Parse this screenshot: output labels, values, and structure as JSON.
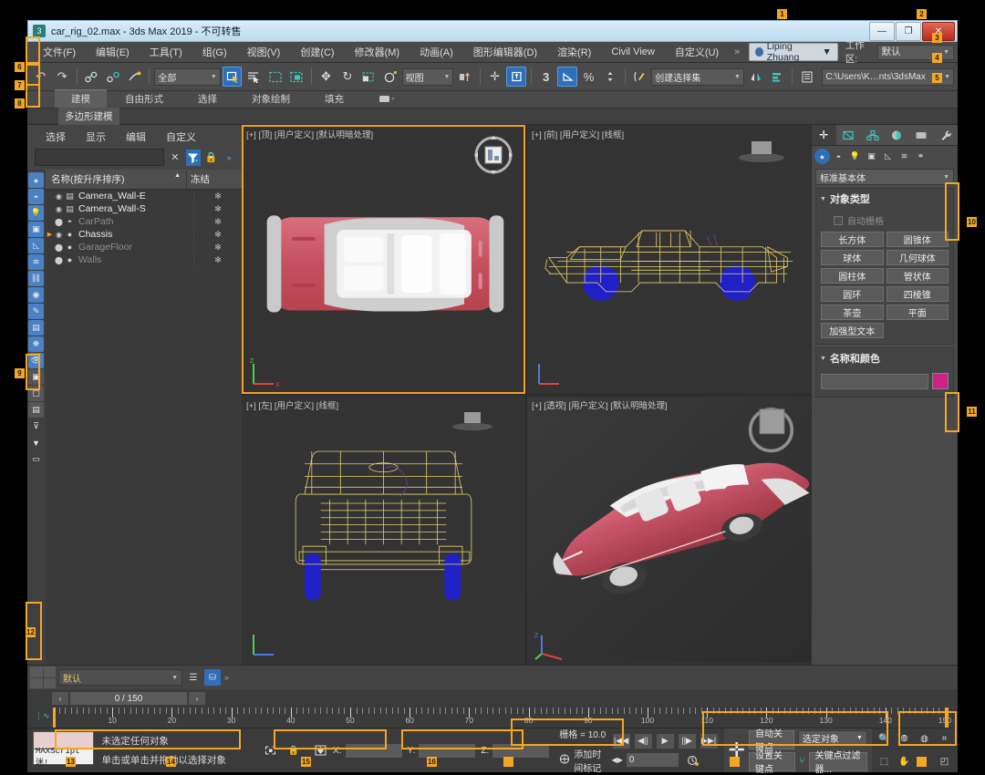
{
  "window": {
    "title": "car_rig_02.max - 3ds Max 2019  - 不可转售",
    "app_icon": "max-icon",
    "buttons": {
      "minimize": "—",
      "maximize": "❐",
      "close": "✕"
    }
  },
  "menu": {
    "items": [
      {
        "label": "文件(F)"
      },
      {
        "label": "编辑(E)"
      },
      {
        "label": "工具(T)"
      },
      {
        "label": "组(G)"
      },
      {
        "label": "视图(V)"
      },
      {
        "label": "创建(C)"
      },
      {
        "label": "修改器(M)"
      },
      {
        "label": "动画(A)"
      },
      {
        "label": "图形编辑器(D)"
      },
      {
        "label": "渲染(R)"
      },
      {
        "label": "Civil View"
      },
      {
        "label": "自定义(U)"
      }
    ],
    "overflow": "»",
    "user": "Liping Zhuang",
    "user_caret": "▼",
    "workspace_label": "工作区:",
    "workspace_value": "默认"
  },
  "toolbar": {
    "undo": "↶",
    "redo": "↷",
    "link": "link-icon",
    "unlink": "unlink-icon",
    "bind": "bind-icon",
    "filter_value": "全部",
    "select_object": "select-icon",
    "select_by_name": "select-name-icon",
    "rect_select": "rect-select-icon",
    "window_cross": "window-crossing-icon",
    "move": "✥",
    "rotate": "↻",
    "scale": "scale-icon",
    "placement": "placement-icon",
    "ref_coord_value": "视图",
    "pivot": "pivot-icon",
    "mirror": "mirror-icon",
    "snap3": "3",
    "angle_snap": "angle-snap-icon",
    "percent_snap": "%",
    "spinner_snap": "spinner-icon",
    "edit_named_sel": "named-sel-icon",
    "named_sel_value": "创建选择集",
    "mirror_tool": "mirror-tool-icon",
    "align": "align-icon",
    "layer_mgr": "layer-manager-icon",
    "path_value": "C:\\Users\\K…nts\\3dsMax"
  },
  "ribbon": {
    "tabs": [
      {
        "label": "建模",
        "active": true
      },
      {
        "label": "自由形式",
        "active": false
      },
      {
        "label": "选择",
        "active": false
      },
      {
        "label": "对象绘制",
        "active": false
      },
      {
        "label": "填充",
        "active": false
      }
    ],
    "overflow_icon": "dropdown-icon",
    "subtitle": "多边形建模"
  },
  "explorer": {
    "menus": [
      "选择",
      "显示",
      "编辑",
      "自定义"
    ],
    "search_value": "",
    "clear_icon": "✕",
    "filter_icon": "filter-icon",
    "lock_icon": "🔒",
    "expand_icon": "»",
    "columns": {
      "name": "名称(按升序排序)",
      "sort_arrow": "▲",
      "frozen": "冻结"
    },
    "rows": [
      {
        "name": "Camera_Wall-E",
        "type": "camera",
        "dim": false,
        "expandable": false,
        "frozen": "✻"
      },
      {
        "name": "Camera_Wall-S",
        "type": "camera",
        "dim": false,
        "expandable": false,
        "frozen": "✻"
      },
      {
        "name": "CarPath",
        "type": "shape",
        "dim": true,
        "expandable": false,
        "frozen": "✻"
      },
      {
        "name": "Chassis",
        "type": "geometry",
        "dim": false,
        "expandable": true,
        "frozen": "✻"
      },
      {
        "name": "GarageFloor",
        "type": "geometry",
        "dim": true,
        "expandable": false,
        "frozen": "✻"
      },
      {
        "name": "Walls",
        "type": "geometry",
        "dim": true,
        "expandable": false,
        "frozen": "✻"
      }
    ],
    "side_icons": [
      {
        "name": "all-icon",
        "glyph": "●",
        "state": "on"
      },
      {
        "name": "geometry-icon",
        "glyph": "◓",
        "state": "on"
      },
      {
        "name": "lights-icon",
        "glyph": "💡",
        "state": "on"
      },
      {
        "name": "cameras-icon",
        "glyph": "▣",
        "state": "on"
      },
      {
        "name": "helpers-icon",
        "glyph": "◺",
        "state": "on"
      },
      {
        "name": "space-warps-icon",
        "glyph": "≋",
        "state": "on"
      },
      {
        "name": "bones-icon",
        "glyph": "⛓",
        "state": "on"
      },
      {
        "name": "groups-icon",
        "glyph": "◉",
        "state": "on"
      },
      {
        "name": "xrefs-icon",
        "glyph": "✎",
        "state": "on"
      },
      {
        "name": "containers-icon",
        "glyph": "▤",
        "state": "on"
      },
      {
        "name": "particles-icon",
        "glyph": "❋",
        "state": "on"
      },
      {
        "name": "visibility-icon",
        "glyph": "👁",
        "state": "on"
      },
      {
        "name": "layers-icon",
        "glyph": "▣",
        "state": "off"
      },
      {
        "name": "objects-icon",
        "glyph": "▢",
        "state": "off"
      },
      {
        "name": "outline-icon",
        "glyph": "▤",
        "state": "off"
      },
      {
        "name": "filter-a-icon",
        "glyph": "⊽",
        "state": "plain"
      },
      {
        "name": "filter-b-icon",
        "glyph": "▼",
        "state": "plain"
      },
      {
        "name": "toolbar-icon",
        "glyph": "▭",
        "state": "plain"
      }
    ]
  },
  "viewports": [
    {
      "label": "[+] [顶] [用户定义] [默认明暗处理]",
      "name": "viewport-top",
      "active": true,
      "shading": "shaded"
    },
    {
      "label": "[+] [前] [用户定义] [线框]",
      "name": "viewport-front",
      "active": false,
      "shading": "wireframe"
    },
    {
      "label": "[+] [左] [用户定义] [线框]",
      "name": "viewport-left",
      "active": false,
      "shading": "wireframe"
    },
    {
      "label": "[+] [透视] [用户定义] [默认明暗处理]",
      "name": "viewport-perspective",
      "active": false,
      "shading": "shaded"
    }
  ],
  "command_panel": {
    "tabs": [
      {
        "name": "create-tab",
        "glyph": "✛",
        "active": true
      },
      {
        "name": "modify-tab",
        "glyph": "⌲",
        "active": false
      },
      {
        "name": "hierarchy-tab",
        "glyph": "⌸",
        "active": false
      },
      {
        "name": "motion-tab",
        "glyph": "◑",
        "active": false
      },
      {
        "name": "display-tab",
        "glyph": "▭",
        "active": false
      },
      {
        "name": "utilities-tab",
        "glyph": "🔧",
        "active": false
      }
    ],
    "subtabs": [
      {
        "name": "geometry-icon",
        "glyph": "●",
        "active": true
      },
      {
        "name": "shapes-icon",
        "glyph": "◓",
        "active": false
      },
      {
        "name": "lights-icon",
        "glyph": "💡",
        "active": false
      },
      {
        "name": "cameras-icon",
        "glyph": "▣",
        "active": false
      },
      {
        "name": "helpers-icon",
        "glyph": "◺",
        "active": false
      },
      {
        "name": "space-warps-icon",
        "glyph": "≋",
        "active": false
      },
      {
        "name": "systems-icon",
        "glyph": "⚭",
        "active": false
      }
    ],
    "category": "标准基本体",
    "object_type": {
      "title": "对象类型",
      "autogrid_label": "自动栅格",
      "autogrid_checked": false,
      "buttons": [
        "长方体",
        "圆锥体",
        "球体",
        "几何球体",
        "圆柱体",
        "管状体",
        "圆环",
        "四棱锥",
        "茶壶",
        "平面",
        "加强型文本"
      ]
    },
    "name_color": {
      "title": "名称和颜色",
      "value": "",
      "color": "#cc2288"
    }
  },
  "timeline": {
    "layer_value": "默认",
    "frame_display": "0 / 150",
    "prev_icon": "‹",
    "next_icon": "›",
    "range_start": 0,
    "range_end": 150,
    "current_frame": 0,
    "tick_labels": [
      10,
      20,
      30,
      40,
      50,
      60,
      70,
      80,
      90,
      100,
      110,
      120,
      130,
      140,
      150
    ]
  },
  "status": {
    "maxscript_label": "MAXScript 迷!",
    "selection_status": "未选定任何对象",
    "hint": "单击或单击并拖动以选择对象",
    "lock_icon": "🔒",
    "selection_lock_icon": "selection-lock-icon",
    "coord_icon": "coord-icon",
    "x_label": "X:",
    "y_label": "Y:",
    "z_label": "Z:",
    "x_value": "",
    "y_value": "",
    "z_value": "",
    "grid_text": "栅格 = 10.0",
    "time_tag": "添加时间标记",
    "time_tag_icon": "time-tag-icon"
  },
  "animation": {
    "playback": [
      {
        "name": "goto-start-button",
        "glyph": "|◀◀"
      },
      {
        "name": "prev-frame-button",
        "glyph": "◀||"
      },
      {
        "name": "play-button",
        "glyph": "▶"
      },
      {
        "name": "next-frame-button",
        "glyph": "||▶"
      },
      {
        "name": "goto-end-button",
        "glyph": "▶▶|"
      }
    ],
    "frame_field_icon": "◀▶",
    "frame_field_value": "0",
    "time_config_icon": "time-config-icon",
    "add_key_icon": "✛",
    "auto_key": "自动关键点",
    "set_key": "设置关键点",
    "filter_target": "选定对象",
    "key_mode_icon": "key-mode-icon",
    "key_filters": "关键点过滤器..."
  },
  "nav_tools": [
    {
      "name": "zoom-icon",
      "glyph": "🔍"
    },
    {
      "name": "zoom-all-icon",
      "glyph": "⦾"
    },
    {
      "name": "zoom-extents-icon",
      "glyph": "◍"
    },
    {
      "name": "zoom-region-icon",
      "glyph": "⌗"
    },
    {
      "name": "field-of-view-icon",
      "glyph": "⬚"
    },
    {
      "name": "pan-icon",
      "glyph": "✋"
    },
    {
      "name": "orbit-icon",
      "glyph": "◕"
    },
    {
      "name": "maximize-viewport-icon",
      "glyph": "◰"
    }
  ],
  "colors": {
    "accent": "#f5a623",
    "titlebar": "#bcdcf0",
    "panel": "#4a4a4a",
    "viewport_bg": "#333333",
    "wireframe": "#e8d26a",
    "wheel": "#2020c8",
    "car_body": "#c9566a",
    "name_color_swatch": "#cc2288"
  },
  "annotations": [
    "1",
    "2",
    "3",
    "4",
    "5",
    "6",
    "7",
    "8",
    "9",
    "10",
    "11",
    "12",
    "13",
    "14",
    "15",
    "16"
  ]
}
